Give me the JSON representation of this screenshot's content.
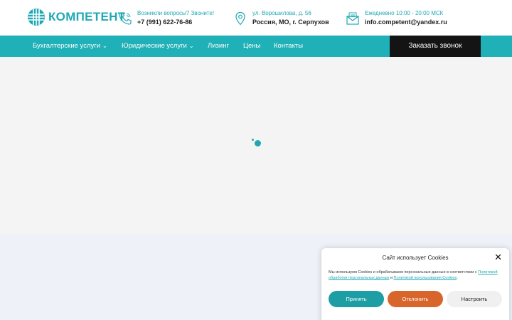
{
  "header": {
    "logo_text": "КОМПЕТЕНТ",
    "phone": {
      "label": "Возникли вопросы? Звоните!",
      "value": "+7 (991) 622-76-86"
    },
    "address": {
      "label": "ул. Ворошилова, д. 56",
      "value": "Россия, МО, г. Серпухов"
    },
    "hours": {
      "label": "Ежедневно 10:00 - 20:00 МСК",
      "value": "info.competent@yandex.ru"
    }
  },
  "nav": {
    "items": [
      {
        "label": "Бухгалтерские услуги",
        "has_submenu": true
      },
      {
        "label": "Юридические услуги",
        "has_submenu": true
      },
      {
        "label": "Лизинг",
        "has_submenu": false
      },
      {
        "label": "Цены",
        "has_submenu": false
      },
      {
        "label": "Контакты",
        "has_submenu": false
      }
    ],
    "cta_label": "Заказать звонок"
  },
  "cookie_banner": {
    "title": "Сайт использует Cookies",
    "text_prefix": "Мы используем Cookies и обрабатываем персональные данные в соответствии с",
    "link_privacy": "Политикой обработки персональных данных",
    "text_and": "и",
    "link_cookies": "Политикой использования Cookies",
    "text_suffix": ".",
    "accept_label": "Принять",
    "reject_label": "Отклонить",
    "settings_label": "Настроить"
  },
  "colors": {
    "accent": "#1fa8b4",
    "nav_bg": "#20b0b7",
    "cta_bg": "#141414",
    "reject": "#d8662c"
  },
  "icons": {
    "logo": "globe-icon",
    "phone": "phone-icon",
    "address": "map-pin-icon",
    "hours": "mail-icon",
    "chevron": "chevron-down-icon",
    "close": "close-icon"
  }
}
